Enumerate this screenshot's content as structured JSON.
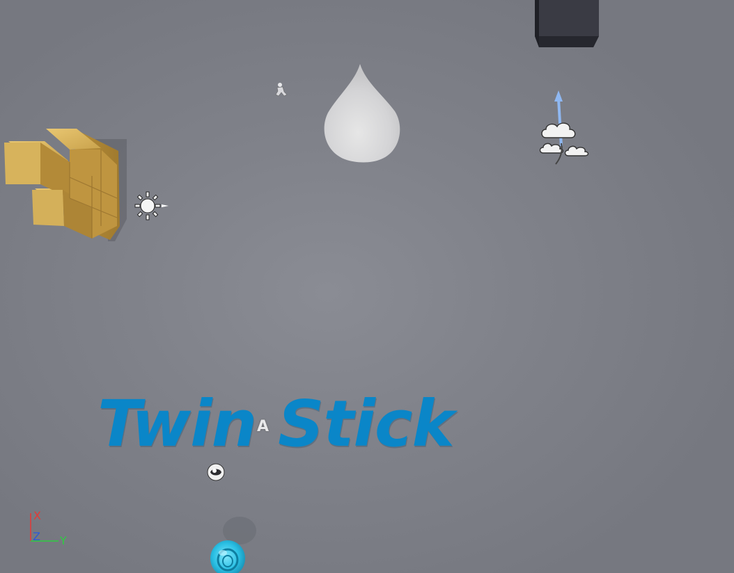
{
  "viewport": {
    "background_color": "#80828a"
  },
  "level_text": {
    "title": "Twin Stick",
    "anchor_label": "A",
    "color": "#0a86c8"
  },
  "axis_gizmo": {
    "x_label": "X",
    "y_label": "Y",
    "z_label": "Z",
    "x_color": "#e53935",
    "y_color": "#2ecc40",
    "z_color": "#2b5bd7"
  },
  "objects": [
    {
      "name": "dark-cube",
      "icon": "cube-mesh"
    },
    {
      "name": "gold-blocks",
      "icon": "block-mesh",
      "color": "#d9b45a"
    },
    {
      "name": "cone",
      "icon": "cone-mesh",
      "color": "#d9d9d9"
    },
    {
      "name": "character",
      "icon": "character-icon"
    },
    {
      "name": "directional-light",
      "icon": "sun-icon"
    },
    {
      "name": "sky-light",
      "icon": "cloud-icon",
      "arrow_color": "#8fb8f2"
    },
    {
      "name": "reflection-capture",
      "icon": "sphere-icon"
    },
    {
      "name": "player-pawn",
      "icon": "pawn-icon",
      "color": "#2bc0e4"
    }
  ]
}
